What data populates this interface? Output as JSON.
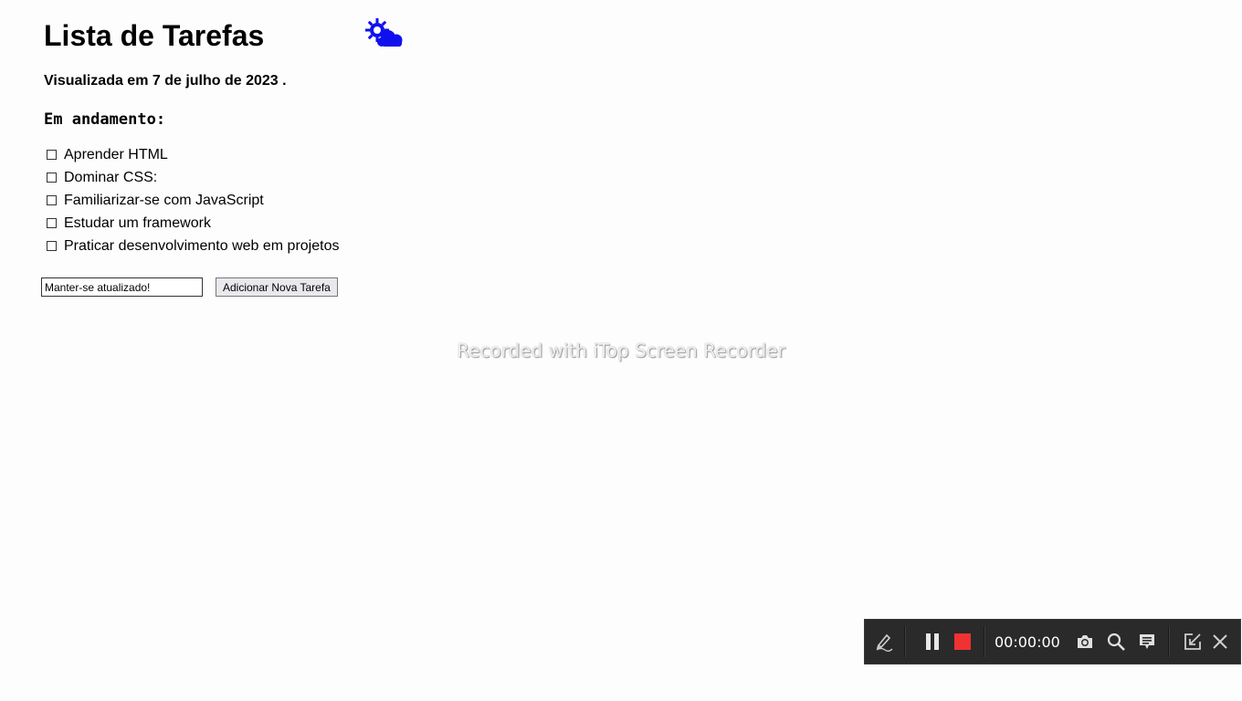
{
  "page": {
    "title": "Lista de Tarefas",
    "viewed_text": "Visualizada em 7 de julho de 2023 .",
    "section_heading": "Em andamento:"
  },
  "tasks": [
    {
      "label": "Aprender HTML",
      "checked": false
    },
    {
      "label": "Dominar CSS:",
      "checked": false
    },
    {
      "label": "Familiarizar-se com JavaScript",
      "checked": false
    },
    {
      "label": "Estudar um framework",
      "checked": false
    },
    {
      "label": "Praticar desenvolvimento web em projetos",
      "checked": false
    }
  ],
  "new_task": {
    "input_value": "Manter-se atualizado!",
    "button_label": "Adicionar Nova Tarefa"
  },
  "icons": {
    "weather": "weather-sun-cloud-icon",
    "weather_color": "#1010ee"
  },
  "watermark": {
    "text": "Recorded with iTop Screen Recorder"
  },
  "recorder": {
    "timer": "00:00:00",
    "stop_color": "#f03232",
    "icons": [
      "pen-icon",
      "pause-icon",
      "stop-icon",
      "camera-icon",
      "zoom-icon",
      "annotation-icon",
      "minimize-icon",
      "close-icon"
    ]
  }
}
